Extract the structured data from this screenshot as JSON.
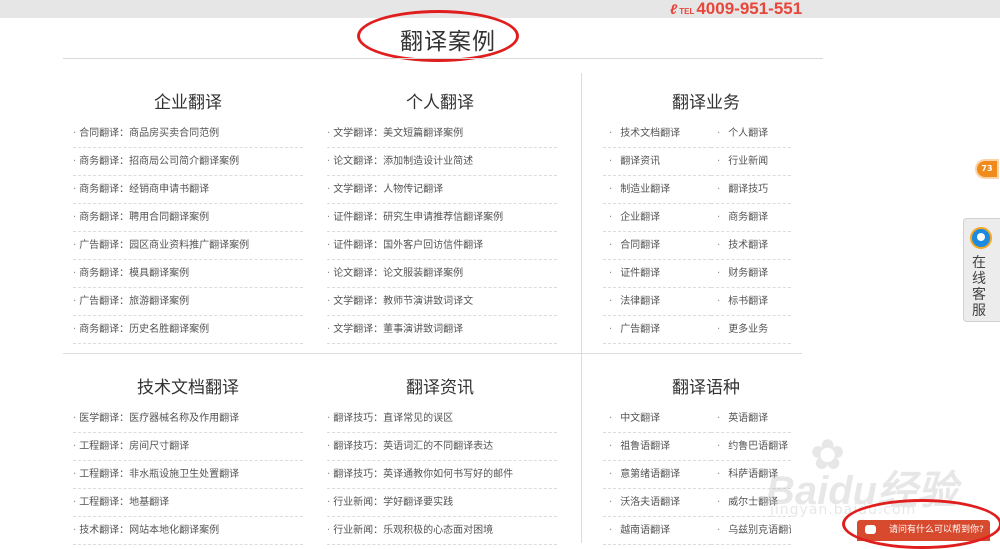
{
  "header": {
    "tel_icon": "ℓ",
    "tel_prefix": "TEL",
    "tel_number": "4009-951-551"
  },
  "page_title": "翻译案例",
  "sections": {
    "enterprise": {
      "title": "企业翻译",
      "items": [
        "合同翻译：商品房买卖合同范例",
        "商务翻译：招商局公司简介翻译案例",
        "商务翻译：经销商申请书翻译",
        "商务翻译：聘用合同翻译案例",
        "广告翻译：园区商业资料推广翻译案例",
        "商务翻译：模具翻译案例",
        "广告翻译：旅游翻译案例",
        "商务翻译：历史名胜翻译案例"
      ]
    },
    "personal": {
      "title": "个人翻译",
      "items": [
        "文学翻译：美文短篇翻译案例",
        "论文翻译：添加制造设计业简述",
        "文学翻译：人物传记翻译",
        "证件翻译：研究生申请推荐信翻译案例",
        "证件翻译：国外客户回访信件翻译",
        "论文翻译：论文服装翻译案例",
        "文学翻译：教师节演讲致词译文",
        "文学翻译：董事演讲致词翻译"
      ]
    },
    "business": {
      "title": "翻译业务",
      "items": [
        "技术文档翻译",
        "个人翻译",
        "翻译资讯",
        "行业新闻",
        "制造业翻译",
        "翻译技巧",
        "企业翻译",
        "商务翻译",
        "合同翻译",
        "技术翻译",
        "证件翻译",
        "财务翻译",
        "法律翻译",
        "标书翻译",
        "广告翻译",
        "更多业务"
      ]
    },
    "technical": {
      "title": "技术文档翻译",
      "items": [
        "医学翻译：医疗器械名称及作用翻译",
        "工程翻译：房间尺寸翻译",
        "工程翻译：非水瓶设施卫生处置翻译",
        "工程翻译：地基翻译",
        "技术翻译：网站本地化翻译案例"
      ]
    },
    "news": {
      "title": "翻译资讯",
      "items": [
        "翻译技巧：直译常见的误区",
        "翻译技巧：英语词汇的不同翻译表达",
        "翻译技巧：英译通教你如何书写好的邮件",
        "行业新闻：学好翻译要实践",
        "行业新闻：乐观积极的心态面对困境"
      ]
    },
    "languages": {
      "title": "翻译语种",
      "items": [
        "中文翻译",
        "英语翻译",
        "祖鲁语翻译",
        "约鲁巴语翻译",
        "意第绪语翻译",
        "科萨语翻译",
        "沃洛夫语翻译",
        "威尔士翻译",
        "越南语翻译",
        "乌兹别克语翻译"
      ]
    }
  },
  "side_badge": "73",
  "customer_service": {
    "label": "在线客服"
  },
  "watermark": {
    "logo": "Baidu经验",
    "url": "jingyan.baidu.com"
  },
  "chat_bar": {
    "text": "请问有什么可以帮到你?"
  },
  "colors": {
    "accent_red": "#e01e1e",
    "tel_red": "#e8463a",
    "chat_bg": "#d84a2e",
    "badge_orange": "#f08a1a"
  }
}
